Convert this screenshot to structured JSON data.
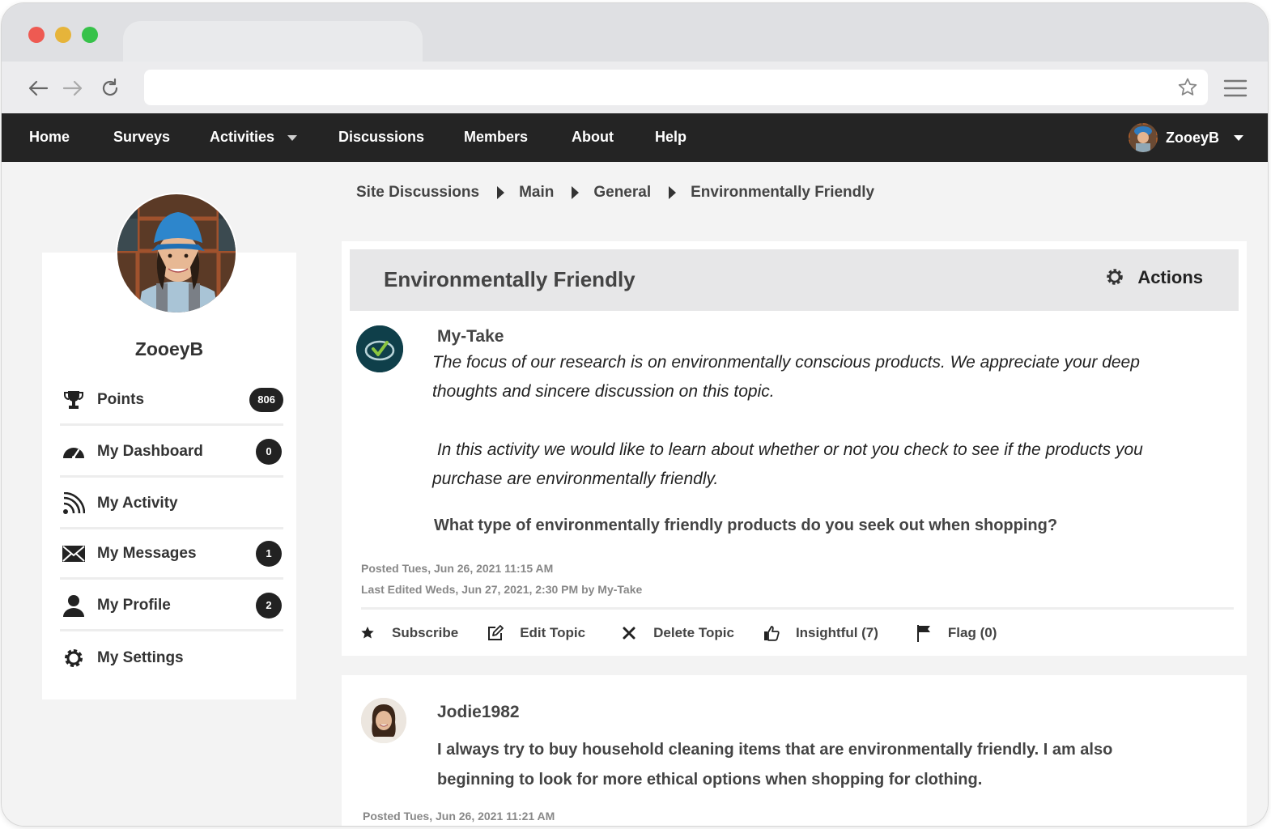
{
  "browser": {
    "url": ""
  },
  "nav": {
    "items": [
      "Home",
      "Surveys",
      "Activities",
      "Discussions",
      "Members",
      "About",
      "Help"
    ],
    "user": "ZooeyB"
  },
  "breadcrumb": [
    "Site Discussions",
    "Main",
    "General",
    "Environmentally Friendly"
  ],
  "sidebar": {
    "username": "ZooeyB",
    "items": [
      {
        "label": "Points",
        "badge": "806",
        "icon": "trophy-icon"
      },
      {
        "label": "My Dashboard",
        "badge": "0",
        "icon": "dashboard-gauge-icon"
      },
      {
        "label": "My Activity",
        "badge": "",
        "icon": "rss-feed-icon"
      },
      {
        "label": "My Messages",
        "badge": "1",
        "icon": "envelope-icon"
      },
      {
        "label": "My Profile",
        "badge": "2",
        "icon": "user-icon"
      },
      {
        "label": "My Settings",
        "badge": "",
        "icon": "gear-icon"
      }
    ]
  },
  "topic": {
    "title": "Environmentally Friendly",
    "actions_label": "Actions",
    "author": "My-Take",
    "body_p1_line1": "The focus of our research is on environmentally conscious products. We appreciate your deep",
    "body_p1_line2": "thoughts and sincere discussion on this topic.",
    "body_p2_line1": " In this activity we would like to learn about whether or not you check to see if the products you",
    "body_p2_line2": "purchase are environmentally friendly.",
    "question": "What type of environmentally friendly products do you seek out when shopping?",
    "posted": "Posted Tues, Jun 26, 2021 11:15 AM",
    "edited": "Last Edited Weds, Jun 27, 2021, 2:30 PM by My-Take",
    "actions": {
      "subscribe": "Subscribe",
      "edit": "Edit Topic",
      "delete": "Delete Topic",
      "insightful": "Insightful (7)",
      "flag": "Flag (0)"
    }
  },
  "reply": {
    "author": "Jodie1982",
    "line1": "I always try to buy household cleaning items that are environmentally friendly. I am also",
    "line2": "beginning to look for more ethical options when shopping for clothing.",
    "posted": "Posted Tues, Jun 26, 2021 11:21 AM"
  },
  "colors": {
    "navbar": "#242424",
    "page_bg": "#f3f3f3",
    "brand_logo": "#0f3f4a",
    "brand_check": "#8bc63f"
  }
}
